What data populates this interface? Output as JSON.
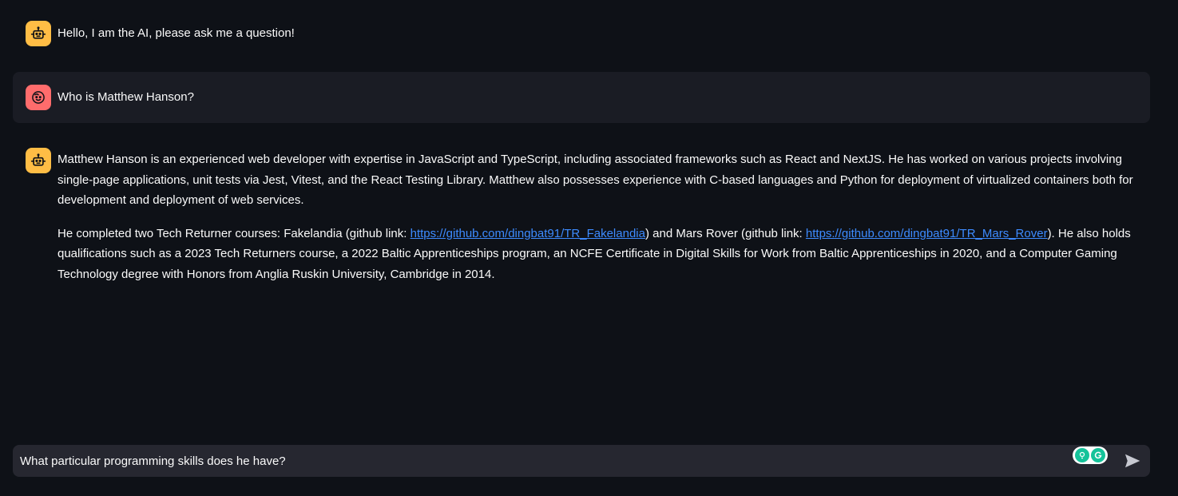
{
  "colors": {
    "background": "#0e1117",
    "user_message_bg": "#1a1c24",
    "ai_avatar": "#ffbd45",
    "user_avatar": "#ff6c6c",
    "link": "#3d8bff",
    "input_bg": "#262730"
  },
  "messages": [
    {
      "role": "assistant",
      "avatar_icon": "robot-icon",
      "paragraphs": [
        "Hello, I am the AI, please ask me a question!"
      ]
    },
    {
      "role": "user",
      "avatar_icon": "smiley-face-icon",
      "paragraphs": [
        "Who is Matthew Hanson?"
      ]
    },
    {
      "role": "assistant",
      "avatar_icon": "robot-icon",
      "paragraphs": [
        "Matthew Hanson is an experienced web developer with expertise in JavaScript and TypeScript, including associated frameworks such as React and NextJS. He has worked on various projects involving single-page applications, unit tests via Jest, Vitest, and the React Testing Library. Matthew also possesses experience with C-based languages and Python for deployment of virtualized containers both for development and deployment of web services."
      ],
      "p2": {
        "t1": "He completed two Tech Returner courses: Fakelandia (github link: ",
        "link1": "https://github.com/dingbat91/TR_Fakelandia",
        "t2": ") and Mars Rover (github link: ",
        "link2": "https://github.com/dingbat91/TR_Mars_Rover",
        "t3": "). He also holds qualifications such as a 2023 Tech Returners course, a 2022 Baltic Apprenticeships program, an NCFE Certificate in Digital Skills for Work from Baltic Apprenticeships in 2020, and a Computer Gaming Technology degree with Honors from Anglia Ruskin University, Cambridge in 2014."
      }
    }
  ],
  "chat_input": {
    "value": "What particular programming skills does he have?",
    "send_icon": "send-arrow-icon",
    "extension_icons": [
      "grammarly-bulb-icon",
      "grammarly-g-icon"
    ]
  }
}
